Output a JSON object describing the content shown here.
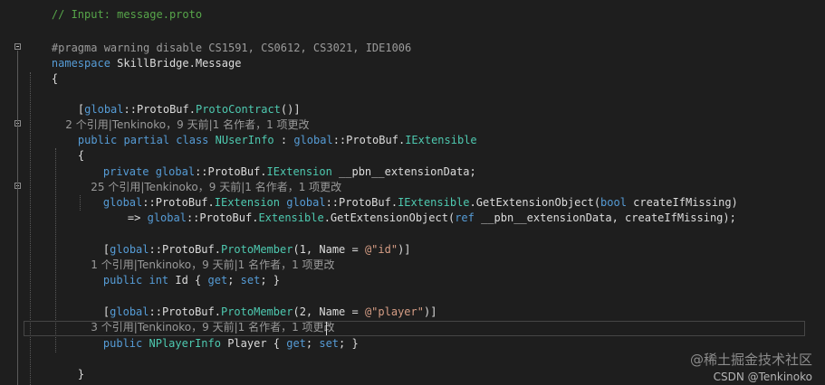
{
  "lines": {
    "l0": "// Input: message.proto",
    "l1": "#pragma warning disable CS1591, CS0612, CS3021, IDE1006",
    "l2_kw": "namespace",
    "l2_name": " SkillBridge.Message",
    "l3": "{",
    "l4_open": "[",
    "l4_global": "global",
    "l4_sep": "::ProtoBuf.",
    "l4_type": "ProtoContract",
    "l4_close": "()]",
    "l5_lens": "2 个引用|Tenkinoko，9 天前|1 名作者，1 项更改",
    "l6_kw": "public partial class",
    "l6_type": " NUserInfo",
    "l6_colon": " : ",
    "l6_global": "global",
    "l6_sep": "::ProtoBuf.",
    "l6_iface": "IExtensible",
    "l7": "{",
    "l8_kw": "private",
    "l8_global": " global",
    "l8_sep": "::ProtoBuf.",
    "l8_type": "IExtension",
    "l8_rest": " __pbn__extensionData;",
    "l9_lens": "25 个引用|Tenkinoko，9 天前|1 名作者，1 项更改",
    "l10_global": "global",
    "l10_sep": "::ProtoBuf.",
    "l10_type": "IExtension",
    "l10_global2": " global",
    "l10_sep2": "::ProtoBuf.",
    "l10_iface": "IExtensible",
    "l10_method": ".GetExtensionObject(",
    "l10_bool": "bool",
    "l10_rest": " createIfMissing)",
    "l11_arrow": "=> ",
    "l11_global": "global",
    "l11_sep": "::ProtoBuf.",
    "l11_type": "Extensible",
    "l11_method": ".GetExtensionObject(",
    "l11_ref": "ref",
    "l11_rest": " __pbn__extensionData, createIfMissing);",
    "l12_open": "[",
    "l12_global": "global",
    "l12_sep": "::ProtoBuf.",
    "l12_type": "ProtoMember",
    "l12_args": "(1, Name = ",
    "l12_str": "@\"id\"",
    "l12_close": ")]",
    "l13_lens": "1 个引用|Tenkinoko，9 天前|1 名作者，1 项更改",
    "l14_kw": "public int",
    "l14_name": " Id { ",
    "l14_get": "get",
    "l14_semi": "; ",
    "l14_set": "set",
    "l14_end": "; }",
    "l15_open": "[",
    "l15_global": "global",
    "l15_sep": "::ProtoBuf.",
    "l15_type": "ProtoMember",
    "l15_args": "(2, Name = ",
    "l15_str": "@\"player\"",
    "l15_close": ")]",
    "l16_lens": "3 个引用|Tenkinoko，9 天前|1 名作者，1 项更改",
    "l17_kw": "public",
    "l17_type": " NPlayerInfo",
    "l17_name": " Player { ",
    "l17_get": "get",
    "l17_semi": "; ",
    "l17_set": "set",
    "l17_end": "; }",
    "l18": "}"
  },
  "watermark": {
    "site": "@稀土掘金技术社区",
    "author": "CSDN @Tenkinoko"
  },
  "colors": {
    "background": "#1e1e1e",
    "keyword": "#569cd6",
    "type": "#4ec9b0",
    "string": "#d69d85",
    "comment": "#57a64a",
    "codelens": "#9a9a9a"
  }
}
